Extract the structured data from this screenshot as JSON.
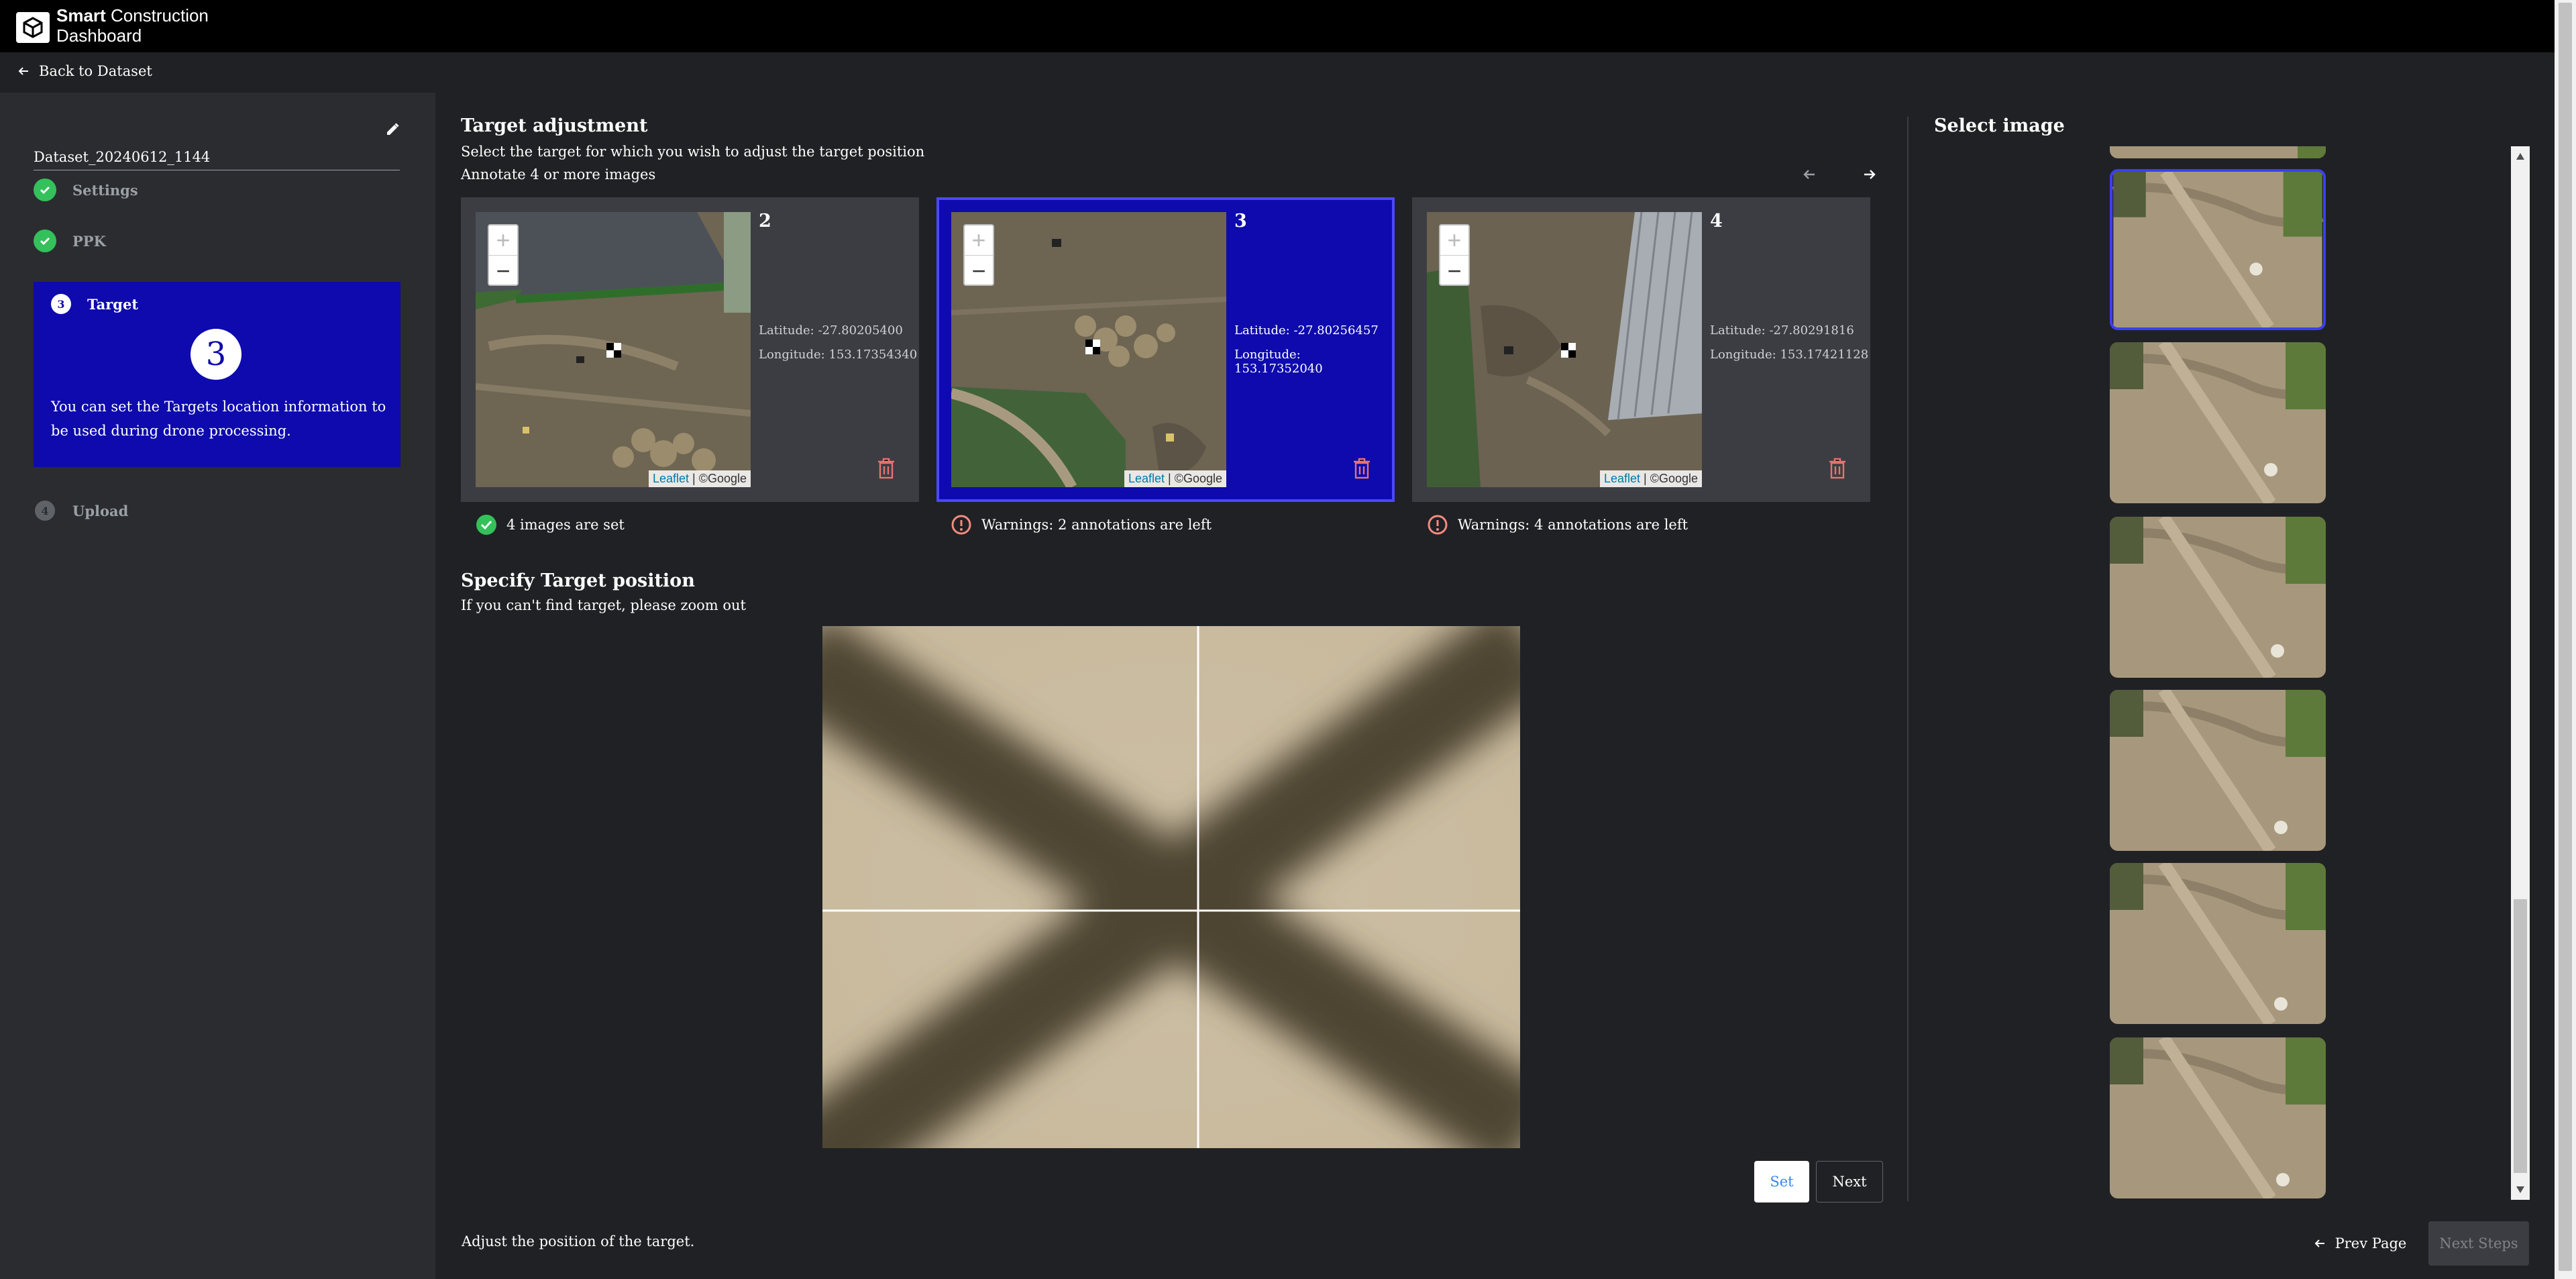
{
  "header": {
    "brand_bold": "Smart",
    "brand_rest": "Construction",
    "brand_line2": "Dashboard"
  },
  "nav": {
    "back_label": "Back to Dataset"
  },
  "sidebar": {
    "dataset_name": "Dataset_20240612_1144",
    "steps": [
      {
        "label": "Settings",
        "state": "done"
      },
      {
        "label": "PPK",
        "state": "done"
      },
      {
        "number": "3",
        "label": "Target",
        "state": "active",
        "big_number": "3",
        "description": "You can set the Targets location information to be used during drone processing."
      },
      {
        "number": "4",
        "label": "Upload",
        "state": "pending"
      }
    ]
  },
  "target_adjustment": {
    "title": "Target adjustment",
    "subtitle": "Select the target for which you wish to adjust the target position",
    "hint": "Annotate 4 or more images",
    "cards": [
      {
        "id": "2",
        "latitude": "Latitude: -27.80205400",
        "longitude": "Longitude: 153.17354340",
        "status": "4 images are set",
        "status_type": "ok",
        "selected": false
      },
      {
        "id": "3",
        "latitude": "Latitude: -27.80256457",
        "longitude": "Longitude: 153.17352040",
        "status": "Warnings: 2 annotations are left",
        "status_type": "warning",
        "selected": true
      },
      {
        "id": "4",
        "latitude": "Latitude: -27.80291816",
        "longitude": "Longitude: 153.17421128",
        "status": "Warnings: 4 annotations are left",
        "status_type": "warning",
        "selected": false
      }
    ],
    "map_attribution": {
      "leaflet": "Leaflet",
      "google": "| ©Google"
    }
  },
  "specify": {
    "title": "Specify Target position",
    "hint": "If you can't find target, please zoom out",
    "set_label": "Set",
    "next_label": "Next"
  },
  "select_image": {
    "title": "Select image",
    "count": 7,
    "active_index": 0
  },
  "footer": {
    "instruction": "Adjust the position of the target.",
    "prev_label": "Prev Page",
    "next_steps_label": "Next Steps"
  },
  "colors": {
    "accent": "#0e0aad",
    "success": "#34c05a",
    "warning": "#f28b82",
    "danger": "#e57373"
  }
}
